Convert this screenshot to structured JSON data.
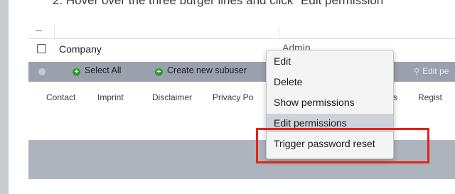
{
  "instruction": "2.   Hover over the three burger lines and click \"Edit permission",
  "table": {
    "row_label": "Company",
    "role_label": "Admin"
  },
  "toolbar": {
    "select_all": "Select All",
    "create_subuser": "Create new subuser",
    "edit_permissions_partial": "Edit pe"
  },
  "footer": {
    "links": [
      "Contact",
      "Imprint",
      "Disclaimer",
      "Privacy Po",
      "s",
      "Regist"
    ]
  },
  "context_menu": {
    "items": [
      "Edit",
      "Delete",
      "Show permissions",
      "Edit permissions",
      "Trigger password reset"
    ],
    "highlighted_item": "Edit permissions"
  },
  "colors": {
    "highlight_box": "#e0261a",
    "toolbar_bg": "#9aa0ad",
    "accent_green": "#2f9e2f"
  },
  "icons": {
    "select_all": "plus-circle-icon",
    "create_subuser": "plus-circle-icon",
    "edit_permissions": "key-icon"
  }
}
